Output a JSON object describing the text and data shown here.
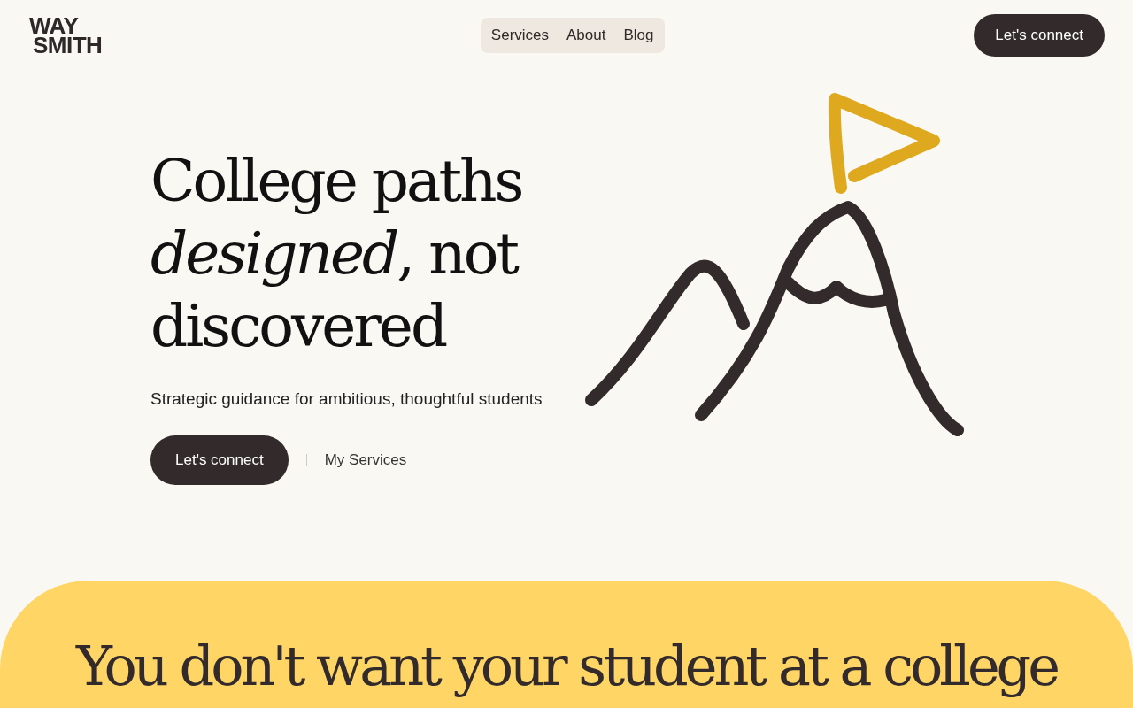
{
  "header": {
    "logo": [
      "WAY",
      "SMITH"
    ],
    "nav": [
      {
        "label": "Services"
      },
      {
        "label": "About"
      },
      {
        "label": "Blog"
      }
    ],
    "cta": "Let's connect"
  },
  "hero": {
    "title_lines": [
      "College paths",
      "*designed*, not",
      "discovered"
    ],
    "subtitle": "Strategic guidance for ambitious, thoughtful students",
    "primary_button": "Let's connect",
    "secondary_link": "My Services"
  },
  "section": {
    "heading": "You don't want your student at a college"
  }
}
